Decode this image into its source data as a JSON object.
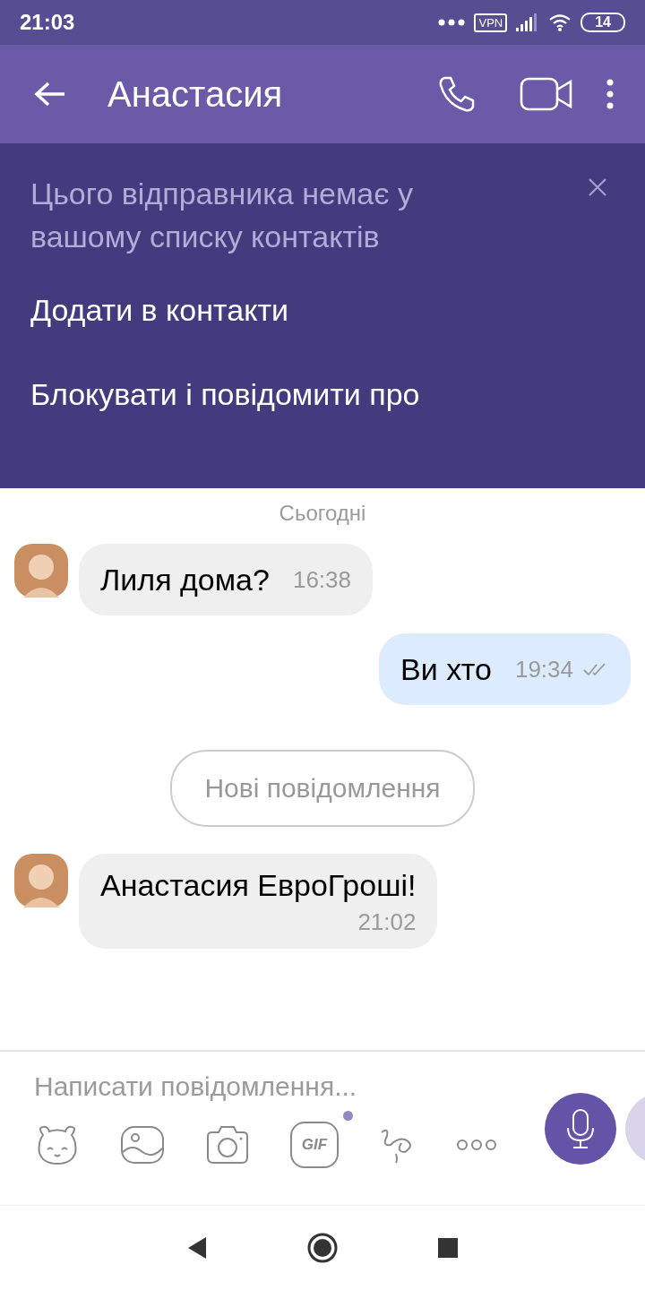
{
  "status_bar": {
    "time": "21:03",
    "vpn": "VPN",
    "battery": "14"
  },
  "header": {
    "title": "Анастасия"
  },
  "banner": {
    "notice": "Цього відправника немає у вашому списку контактів",
    "actions": [
      "Додати в контакти",
      "Блокувати і повідомити про"
    ]
  },
  "chat": {
    "date": "Сьогодні",
    "messages": [
      {
        "kind": "incoming",
        "text": "Лиля дома?",
        "time": "16:38",
        "time_below": false
      },
      {
        "kind": "outgoing",
        "text": "Ви хто",
        "time": "19:34",
        "read": true
      },
      {
        "kind": "divider",
        "text": "Нові повідомлення"
      },
      {
        "kind": "incoming",
        "text": "Анастасия ЕвроГроші!",
        "time": "21:02",
        "time_below": true
      }
    ]
  },
  "composer": {
    "placeholder": "Написати повідомлення...",
    "gif_label": "GIF",
    "gif_new": true
  }
}
